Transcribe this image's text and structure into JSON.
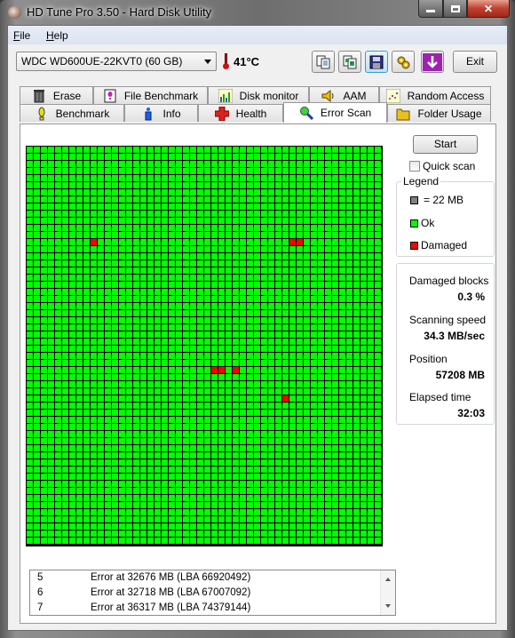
{
  "window": {
    "title": "HD Tune Pro 3.50 - Hard Disk Utility",
    "caption_buttons": {
      "minimize": "—",
      "maximize": "□",
      "close": "✕"
    }
  },
  "menu": [
    {
      "label": "File",
      "mnemonic": "F",
      "rest": "ile"
    },
    {
      "label": "Help",
      "mnemonic": "H",
      "rest": "elp"
    }
  ],
  "toolbar": {
    "drive": "WDC WD600UE-22KVT0 (60 GB)",
    "temperature": "41°C",
    "buttons": [
      {
        "icon": "copy-text-icon"
      },
      {
        "icon": "copy-screenshot-icon"
      },
      {
        "icon": "save-icon"
      },
      {
        "icon": "options-icon"
      },
      {
        "icon": "download-icon"
      }
    ],
    "exit_label": "Exit"
  },
  "tabs": {
    "top": [
      {
        "label": "Erase",
        "icon": "trash-icon"
      },
      {
        "label": "File Benchmark",
        "icon": "file-benchmark-icon"
      },
      {
        "label": "Disk monitor",
        "icon": "disk-monitor-icon"
      },
      {
        "label": "AAM",
        "icon": "speaker-icon"
      },
      {
        "label": "Random Access",
        "icon": "random-access-icon"
      }
    ],
    "bottom": [
      {
        "label": "Benchmark",
        "icon": "benchmark-icon"
      },
      {
        "label": "Info",
        "icon": "info-icon"
      },
      {
        "label": "Health",
        "icon": "health-cross-icon"
      },
      {
        "label": "Error Scan",
        "icon": "magnifier-icon",
        "selected": true
      },
      {
        "label": "Folder Usage",
        "icon": "folder-icon"
      }
    ]
  },
  "error_scan": {
    "start_label": "Start",
    "quick_scan_label": "Quick scan",
    "quick_scan_checked": false,
    "legend": {
      "title": "Legend",
      "block_size": "= 22 MB",
      "ok_label": "Ok",
      "damaged_label": "Damaged"
    },
    "colors": {
      "ok": "#00ff00",
      "damaged": "#ff0000",
      "block": "#808080",
      "grid_line": "#000000"
    },
    "grid": {
      "cols": 50,
      "rows": 56,
      "damaged_cells": [
        [
          13,
          9
        ],
        [
          13,
          37
        ],
        [
          13,
          38
        ],
        [
          31,
          26
        ],
        [
          31,
          27
        ],
        [
          31,
          29
        ],
        [
          35,
          36
        ]
      ]
    },
    "stats": {
      "damaged_blocks_label": "Damaged blocks",
      "damaged_blocks": "0.3 %",
      "speed_label": "Scanning speed",
      "speed": "34.3 MB/sec",
      "position_label": "Position",
      "position": "57208 MB",
      "elapsed_label": "Elapsed time",
      "elapsed": "32:03"
    },
    "log": [
      {
        "n": "5",
        "msg": "Error at 32676 MB (LBA 66920492)"
      },
      {
        "n": "6",
        "msg": "Error at 32718 MB (LBA 67007092)"
      },
      {
        "n": "7",
        "msg": "Error at 36317 MB (LBA 74379144)"
      }
    ]
  }
}
